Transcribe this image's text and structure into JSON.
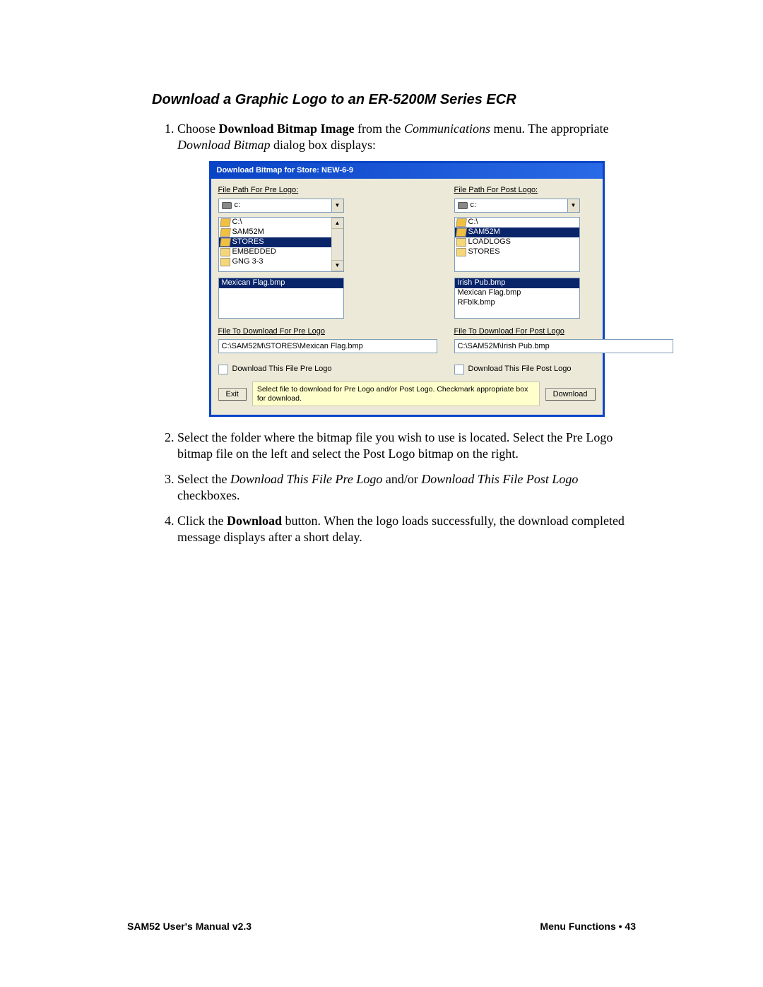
{
  "heading": "Download a Graphic Logo to an ER-5200M Series ECR",
  "step1": {
    "pre": "Choose ",
    "bold": "Download Bitmap Image",
    "mid": " from the ",
    "em1": "Communications",
    "mid2": " menu.  The appropriate ",
    "em2": "Download Bitmap",
    "end": " dialog box displays:"
  },
  "dialog": {
    "title": "Download Bitmap for Store: NEW-6-9",
    "pre": {
      "path_label": "File Path For Pre Logo:",
      "drive": "c:",
      "folders": [
        {
          "name": "C:\\",
          "sel": false,
          "open": true,
          "indent": 0
        },
        {
          "name": "SAM52M",
          "sel": false,
          "open": true,
          "indent": 1
        },
        {
          "name": "STORES",
          "sel": true,
          "open": true,
          "indent": 2
        },
        {
          "name": "EMBEDDED",
          "sel": false,
          "open": false,
          "indent": 3
        },
        {
          "name": "GNG 3-3",
          "sel": false,
          "open": false,
          "indent": 3
        }
      ],
      "files": [
        {
          "name": "Mexican Flag.bmp",
          "sel": true
        }
      ],
      "file_label": "File To Download For Pre Logo",
      "file_value": "C:\\SAM52M\\STORES\\Mexican Flag.bmp",
      "cb_label": "Download This File Pre Logo"
    },
    "post": {
      "path_label": "File Path For Post Logo:",
      "drive": "c:",
      "folders": [
        {
          "name": "C:\\",
          "sel": false,
          "open": true,
          "indent": 0
        },
        {
          "name": "SAM52M",
          "sel": true,
          "open": true,
          "indent": 1
        },
        {
          "name": "LOADLOGS",
          "sel": false,
          "open": false,
          "indent": 2
        },
        {
          "name": "STORES",
          "sel": false,
          "open": false,
          "indent": 2
        }
      ],
      "files": [
        {
          "name": "Irish Pub.bmp",
          "sel": true
        },
        {
          "name": "Mexican Flag.bmp",
          "sel": false
        },
        {
          "name": "RFblk.bmp",
          "sel": false
        }
      ],
      "file_label": "File To Download For Post Logo",
      "file_value": "C:\\SAM52M\\Irish Pub.bmp",
      "cb_label": "Download This File Post Logo"
    },
    "exit_btn": "Exit",
    "download_btn": "Download",
    "hint": "Select file to download for Pre Logo and/or Post Logo.  Checkmark appropriate box for download."
  },
  "step2": "Select the folder where the bitmap file you wish to use is located.  Select the Pre Logo bitmap file on the left and select the Post Logo bitmap on the right.",
  "step3": {
    "pre": "Select the ",
    "em1": "Download This File Pre Logo",
    "mid": " and/or ",
    "em2": "Download This File Post Logo",
    "end": " checkboxes."
  },
  "step4": {
    "pre": "Click the ",
    "bold": "Download",
    "end": " button.  When the logo loads successfully, the download completed message displays after a short delay."
  },
  "footer": {
    "left": "SAM52 User's Manual v2.3",
    "right": "Menu Functions  •  43"
  }
}
